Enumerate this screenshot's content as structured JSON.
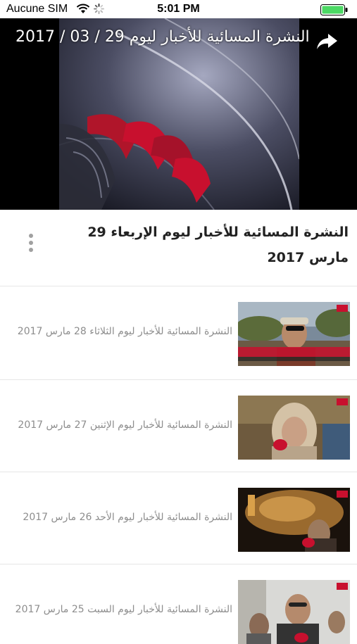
{
  "status_bar": {
    "carrier": "Aucune SIM",
    "time": "5:01 PM"
  },
  "player": {
    "title": "النشرة المسائية للأخبار ليوم 29 / 03 / 2017"
  },
  "current_video": {
    "title": "النشرة المسائية للأخبار ليوم الإربعاء 29 مارس 2017"
  },
  "related": [
    {
      "title": "النشرة المسائية للأخبار ليوم الثلاثاء 28 مارس 2017"
    },
    {
      "title": "النشرة المسائية للأخبار ليوم الإثنين 27 مارس 2017"
    },
    {
      "title": "النشرة المسائية للأخبار ليوم الأحد 26 مارس 2017"
    },
    {
      "title": "النشرة المسائية للأخبار ليوم السبت 25 مارس 2017"
    }
  ],
  "colors": {
    "accent_red": "#c8102e",
    "battery_green": "#4cd964",
    "divider": "#e6e6e6",
    "meta_text": "#8d8d8d"
  },
  "icons": [
    "wifi-icon",
    "loading-spinner-icon",
    "battery-icon",
    "share-icon",
    "more-options-icon"
  ]
}
